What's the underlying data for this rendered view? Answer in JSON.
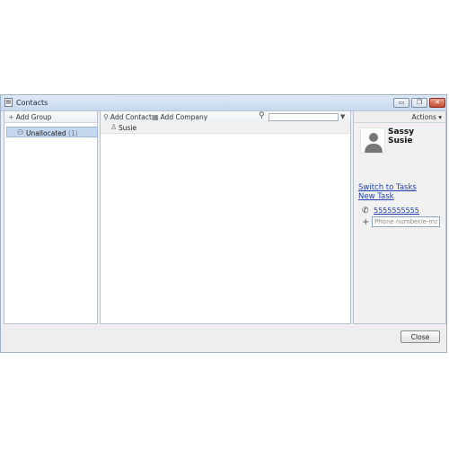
{
  "window": {
    "title": "Contacts",
    "controls": {
      "minimize": "▭",
      "restore": "❐",
      "close": "✕"
    }
  },
  "groups_panel": {
    "add_label": "Add Group",
    "items": [
      {
        "label": "Unallocated",
        "count": "(1)"
      }
    ]
  },
  "contacts_panel": {
    "add_contact_label": "Add Contact",
    "add_company_label": "Add Company",
    "search": {
      "value": "",
      "placeholder": ""
    },
    "contacts": [
      {
        "name": "Susie"
      }
    ]
  },
  "details_panel": {
    "actions_label": "Actions ▾",
    "name_first": "Sassy",
    "name_last": "Susie",
    "switch_link": "Switch to Tasks",
    "new_task_link": "New Task",
    "phone": "5555555555",
    "phone_input_placeholder": "Phone number/e-mail",
    "phone_input_value": ""
  },
  "footer": {
    "close_label": "Close"
  },
  "icons": {
    "window_icon": "contacts-window-icon",
    "add_group": "plus-icon",
    "group": "group-icon",
    "add_contact": "add-contact-icon",
    "add_company": "add-company-icon",
    "search": "magnifier-icon",
    "contact": "person-icon",
    "phone": "phone-icon",
    "add_field": "plus-icon"
  },
  "colors": {
    "selection": "#c5d8ef",
    "link": "#1f3fb0",
    "titlebar": "#c7d9ee",
    "close_control": "#c74a32"
  }
}
